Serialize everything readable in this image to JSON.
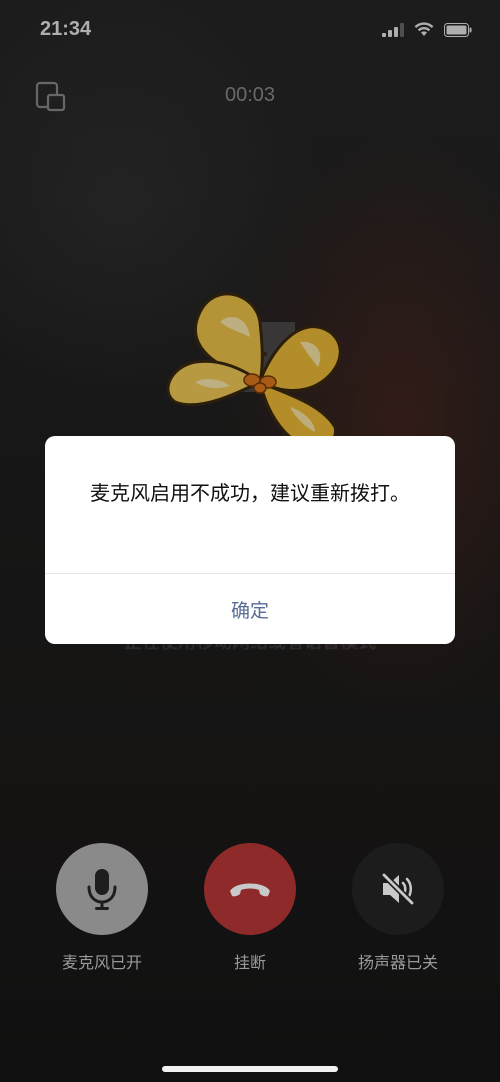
{
  "status_bar": {
    "time": "21:34",
    "icons": [
      "signal-icon",
      "wifi-icon",
      "battery-icon"
    ]
  },
  "call": {
    "timer": "00:03",
    "background_hint": "正在使用移动网络或者语音模式"
  },
  "dialog": {
    "message": "麦克风启用不成功，建议重新拨打。",
    "confirm_label": "确定",
    "confirm_color": "#576b95"
  },
  "controls": {
    "mic_label": "麦克风已开",
    "hangup_label": "挂断",
    "speaker_label": "扬声器已关",
    "mic_color": "#8a8a8a",
    "hangup_color": "#8f2a2a",
    "speaker_color": "#1c1c1c"
  }
}
